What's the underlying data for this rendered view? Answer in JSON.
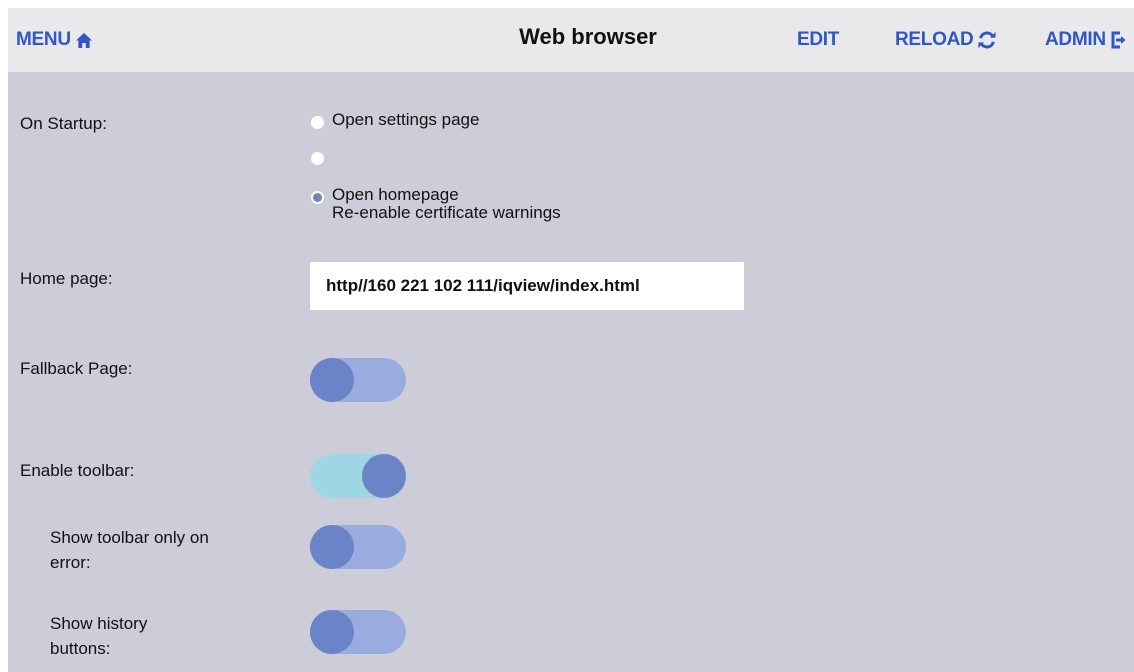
{
  "header": {
    "menu_label": "MENU",
    "title": "Web browser",
    "edit_label": "EDIT",
    "reload_label": "RELOAD",
    "admin_label": "ADMIN"
  },
  "settings": {
    "startup": {
      "label": "On Startup:",
      "options": [
        {
          "text": "Open  settings page",
          "selected": false
        },
        {
          "text": "",
          "selected": false
        },
        {
          "text": "Open  homepage",
          "subtext": "Re-enable certificate warnings",
          "selected": true
        }
      ]
    },
    "home_page": {
      "label": "Home page:",
      "value": "http//160 221 102 111/iqview/index.html"
    },
    "fallback_page": {
      "label": "Fallback Page:",
      "enabled": false
    },
    "enable_toolbar": {
      "label": "Enable toolbar:",
      "enabled": true
    },
    "toolbar_only_on_error": {
      "label_line1": "Show toolbar only on",
      "label_line2": "error:",
      "enabled": false
    },
    "history_buttons": {
      "label_line1": "Show  history",
      "label_line2": "buttons:",
      "enabled": false
    }
  },
  "colors": {
    "accent": "#2f58c6",
    "toggle_knob": "#6b83c7",
    "toggle_track_off": "#9aabe0",
    "toggle_track_on": "#9ed6e4",
    "panel_background": "#cccdd8",
    "header_background": "#e9e9ec"
  },
  "icons": {
    "menu": "home-icon",
    "reload": "reload-icon",
    "admin": "logout-icon"
  }
}
